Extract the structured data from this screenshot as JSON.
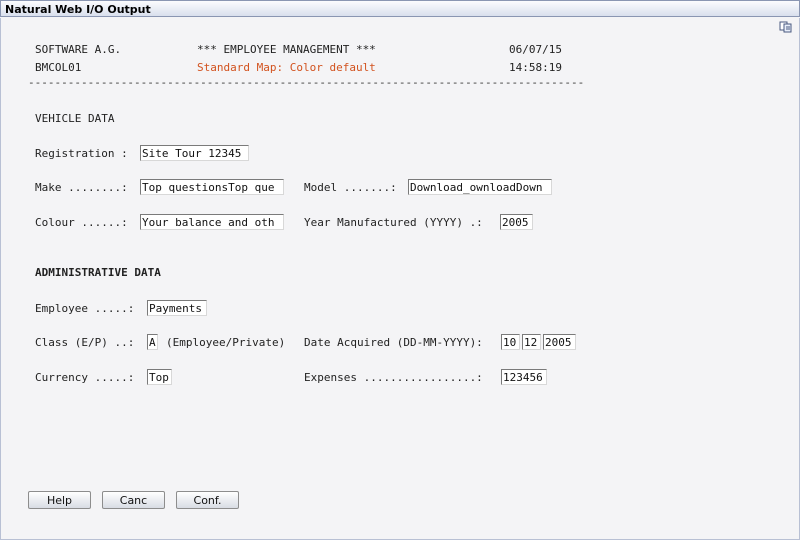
{
  "window": {
    "title": "Natural Web I/O Output"
  },
  "header": {
    "company": "SOFTWARE A.G.",
    "app_title": "*** EMPLOYEE MANAGEMENT ***",
    "date": "06/07/15",
    "program": "BMCOL01",
    "map_name": "Standard Map: Color default",
    "time": "14:58:19",
    "separator": "------------------------------------------------------------------------------------------------"
  },
  "vehicle": {
    "section_title": "VEHICLE DATA",
    "registration_label": "Registration :",
    "registration_value": "Site Tour 12345",
    "make_label": "Make ........:",
    "make_value": "Top questionsTop que",
    "model_label": "Model .......:",
    "model_value": "Download_ownloadDown",
    "colour_label": "Colour ......:",
    "colour_value": "Your balance and oth",
    "year_label": "Year Manufactured (YYYY) .:",
    "year_value": "2005"
  },
  "admin": {
    "section_title": "ADMINISTRATIVE DATA",
    "employee_label": "Employee .....:",
    "employee_value": "Payments",
    "class_label": "Class (E/P) ..:",
    "class_value": "A",
    "class_hint": "(Employee/Private)",
    "date_label": "Date Acquired (DD-MM-YYYY):",
    "date_day": "10",
    "date_month": "12",
    "date_year": "2005",
    "currency_label": "Currency .....:",
    "currency_value": "Top",
    "expenses_label": "Expenses .................:",
    "expenses_value": "123456"
  },
  "buttons": {
    "help": "Help",
    "cancel": "Canc",
    "confirm": "Conf."
  },
  "icons": {
    "copy": "copy-icon"
  }
}
